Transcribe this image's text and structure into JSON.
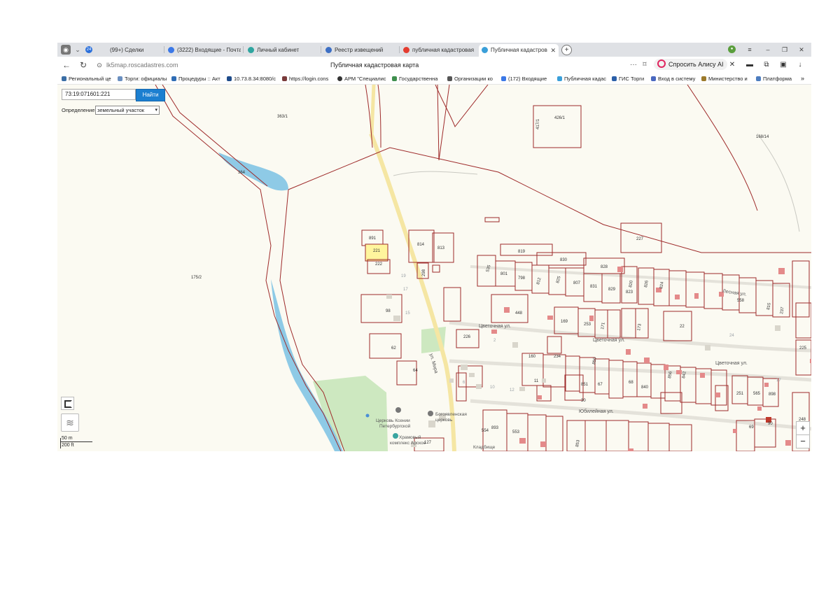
{
  "browser": {
    "tabs": [
      {
        "label": "(99+) Сделки",
        "icon": "crm-icon",
        "active": false
      },
      {
        "label": "(3222) Входящие - Почта",
        "icon": "mail-icon",
        "active": false
      },
      {
        "label": "Личный кабинет",
        "icon": "cabinet-icon",
        "active": false
      },
      {
        "label": "Реестр извещений",
        "icon": "shield-icon",
        "active": false
      },
      {
        "label": "публичная кадастровая",
        "icon": "yandex-icon",
        "active": false
      },
      {
        "label": "Публичная кадастров",
        "icon": "map-icon",
        "active": true
      }
    ],
    "url": "lk5map.roscadastres.com",
    "page_title": "Публичная кадастровая карта",
    "alisa_label": "Спросить Алису AI",
    "bookmarks": [
      "Региональный це",
      "Торги: официалы",
      "Процедуры :: Акт",
      "10.73.8.34:8080/c",
      "https://login.cons",
      "АРМ \"Специалис",
      "Государственна",
      "Организации ко",
      "(172) Входящие",
      "Публичная кадас",
      "ГИС Торги",
      "Вход в систему",
      "Министерство и",
      "Платформа"
    ],
    "bookmarks_more": "»"
  },
  "map": {
    "search_value": "73:19:071601:221",
    "find_button": "Найти",
    "definition_label": "Определение:",
    "definition_value": "земельный участок",
    "scale_m": "50 m",
    "scale_ft": "200 ft",
    "zoom_in": "+",
    "zoom_out": "−",
    "streets": {
      "mira": "ул. Мира",
      "lesnaya": "Лесная ул.",
      "tsvetochnaya1": "Цветочная ул.",
      "tsvetochnaya2": "Цветочная ул.",
      "tsvetochnaya3": "Цветочная ул.",
      "yubileynaya": "Юбилейная ул."
    },
    "pois": {
      "church1_line1": "Церковь Ксении",
      "church1_line2": "Петербургской",
      "church2_line1": "Богоявленская",
      "church2_line2": "церковь",
      "complex_line1": "Храмовый",
      "complex_line2": "комплекс Арское",
      "kladbishche": "Кладбище"
    },
    "parcel_labels": {
      "p3631": "363/1",
      "p364": "364",
      "p1752": "175/2",
      "p4261": "426/1",
      "p4171": "417/1",
      "p16814": "168/14",
      "p227": "227",
      "p891": "891",
      "p221": "221",
      "p222": "222",
      "p814": "814",
      "p813": "813",
      "p298": "298",
      "p98": "98",
      "p62": "62",
      "p64": "64",
      "p127": "127",
      "p19": "19",
      "p17": "17",
      "p15": "15",
      "p819": "819",
      "p830": "830",
      "p828": "828",
      "p535": "535",
      "p801": "801",
      "p798": "798",
      "p812": "812",
      "p825": "825",
      "p807": "807",
      "p831": "831",
      "p829": "829",
      "p823": "823",
      "p820": "820",
      "p826": "826",
      "p824": "824",
      "p448": "448",
      "p169": "169",
      "p253": "253",
      "p171": "171",
      "p173": "173",
      "p22": "22",
      "p558": "558",
      "p815": "815",
      "p237": "237",
      "p226": "226",
      "p160": "160",
      "p234": "234",
      "p850": "850",
      "p851": "851",
      "p67": "67",
      "p68": "68",
      "p840": "840",
      "p856": "856",
      "p842": "842",
      "p251": "251",
      "p565": "565",
      "p898": "898",
      "p893": "893",
      "p553": "553",
      "p554": "554",
      "p853": "853",
      "p69": "69",
      "p90": "90",
      "p248": "248",
      "p218": "218",
      "p225": "225",
      "p30": "30",
      "p17b": "17",
      "p24": "24",
      "p2": "2",
      "p6": "6",
      "p10": "10",
      "p11": "11",
      "p12": "12"
    }
  },
  "colors": {
    "parcel_border": "#9e2a2a",
    "selected_parcel": "#fff59d",
    "road": "#f5e6a3",
    "water": "#8ecae6",
    "park": "#cde8c0",
    "find_button": "#1c7fd0"
  }
}
